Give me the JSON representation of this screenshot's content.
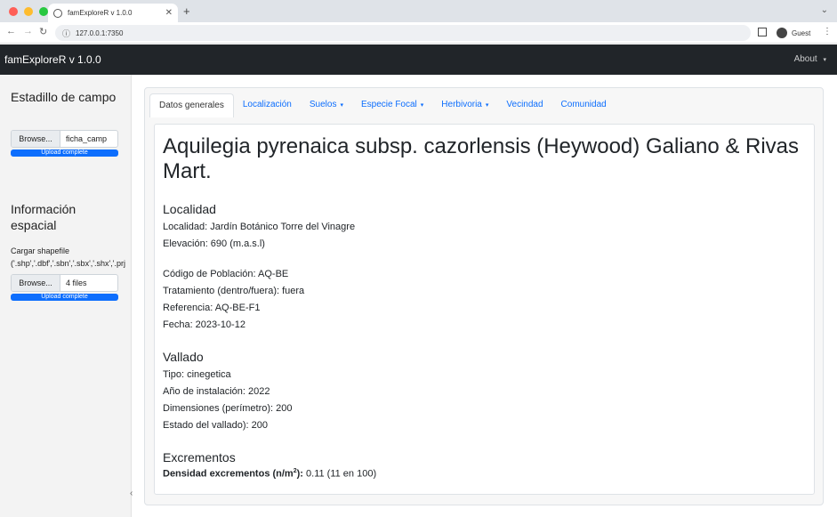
{
  "browser": {
    "tab_title": "famExploreR v 1.0.0",
    "url": "127.0.0.1:7350",
    "profile_name": "Guest"
  },
  "navbar": {
    "brand": "famExploreR v 1.0.0",
    "about": "About"
  },
  "sidebar": {
    "estadillo_title": "Estadillo de campo",
    "browse_label": "Browse...",
    "estadillo_file": "ficha_camp",
    "estadillo_status": "Upload complete",
    "estadillo_progress": 1.0,
    "info_title": "Información espacial",
    "shapefile_label": "Cargar shapefile",
    "shapefile_ext": "('.shp','.dbf','.sbn','.sbx','.shx','.prj",
    "shapefile_files": "4 files",
    "shapefile_status": "Upload complete",
    "shapefile_progress": 1.0
  },
  "tabs": [
    {
      "label": "Datos generales",
      "dropdown": false
    },
    {
      "label": "Localización",
      "dropdown": false
    },
    {
      "label": "Suelos",
      "dropdown": true
    },
    {
      "label": "Especie Focal",
      "dropdown": true
    },
    {
      "label": "Herbivoria",
      "dropdown": true
    },
    {
      "label": "Vecindad",
      "dropdown": false
    },
    {
      "label": "Comunidad",
      "dropdown": false
    }
  ],
  "content": {
    "species": "Aquilegia pyrenaica subsp. cazorlensis (Heywood) Galiano & Rivas Mart.",
    "localidad_heading": "Localidad",
    "localidad": "Localidad: Jardín Botánico Torre del Vinagre",
    "elevacion": "Elevación: 690 (m.a.s.l)",
    "codigo": "Código de Población: AQ-BE",
    "tratamiento": "Tratamiento (dentro/fuera): fuera",
    "referencia": "Referencia: AQ-BE-F1",
    "fecha": "Fecha: 2023-10-12",
    "vallado_heading": "Vallado",
    "tipo": "Tipo: cinegetica",
    "anio": "Año de instalación: 2022",
    "dimensiones": "Dimensiones (perímetro): 200",
    "estado": "Estado del vallado): 200",
    "excrementos_heading": "Excrementos",
    "densidad_label": "Densidad excrementos (n/m",
    "densidad_sup": "2",
    "densidad_suffix": "):",
    "densidad_value": "0.11 (11 en 100)"
  },
  "colors": {
    "navbar_bg": "#212529",
    "primary": "#0d6efd",
    "sidebar_bg": "#f3f3f3"
  }
}
